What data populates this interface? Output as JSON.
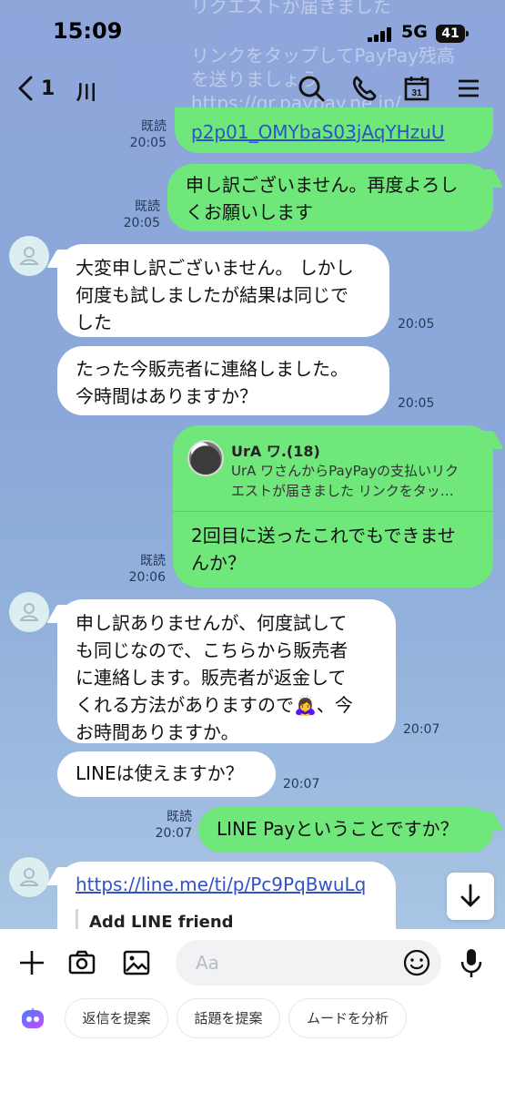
{
  "background_text": [
    "リクエストが届きました",
    "リンクをタップしてPayPay残高",
    "を送りましょう",
    "https://qr.paypay.ne.jp/"
  ],
  "status_bar": {
    "time": "15:09",
    "network": "5G",
    "battery": "41"
  },
  "header": {
    "unread_count": "1",
    "title": "川"
  },
  "messages": [
    {
      "type": "sent",
      "read": "既読",
      "time": "20:05",
      "link": "p2p01_OMYbaS03jAqYHzuU"
    },
    {
      "type": "sent",
      "read": "既読",
      "time": "20:05",
      "lines": [
        "申し訳ございません。再度よろし",
        "くお願いします"
      ]
    },
    {
      "type": "received",
      "time": "20:05",
      "lines": [
        "大変申し訳ございません。 しかし",
        "何度も試しましたが結果は同じで",
        "した"
      ]
    },
    {
      "type": "received",
      "time": "20:05",
      "lines": [
        "たった今販売者に連絡しました。",
        "今時間はありますか？"
      ]
    },
    {
      "type": "sent",
      "read": "既読",
      "time": "20:06",
      "quote_name": "UrA ワ.(18)",
      "quote_lines": [
        "UrA ワさんからPayPayの支払いリク",
        "エストが届きました リンクをタッ…"
      ],
      "lines": [
        "2回目に送ったこれでもできませ",
        "んか？"
      ]
    },
    {
      "type": "received",
      "time": "20:07",
      "lines": [
        "申し訳ありませんが、何度試して",
        "も同じなので、こちらから販売者",
        "に連絡します。販売者が返金して",
        "くれる方法がありますので🙇‍♀️、今",
        "お時間ありますか。"
      ]
    },
    {
      "type": "received",
      "time": "20:07",
      "lines": [
        "LINEは使えますか？"
      ]
    },
    {
      "type": "sent",
      "read": "既読",
      "time": "20:07",
      "lines": [
        "LINE Payということですか？"
      ]
    },
    {
      "type": "received",
      "link": "https://line.me/ti/p/Pc9PqBwuLq",
      "preview_title": "Add LINE friend"
    }
  ],
  "composer": {
    "placeholder": "Aa"
  },
  "suggestions": [
    "返信を提案",
    "話題を提案",
    "ムードを分析"
  ],
  "icons": [
    "back-icon",
    "search-icon",
    "phone-icon",
    "calendar-icon",
    "menu-icon",
    "scroll-down-icon",
    "plus-icon",
    "camera-icon",
    "image-icon",
    "emoji-icon",
    "mic-icon",
    "ai-assistant-icon"
  ]
}
